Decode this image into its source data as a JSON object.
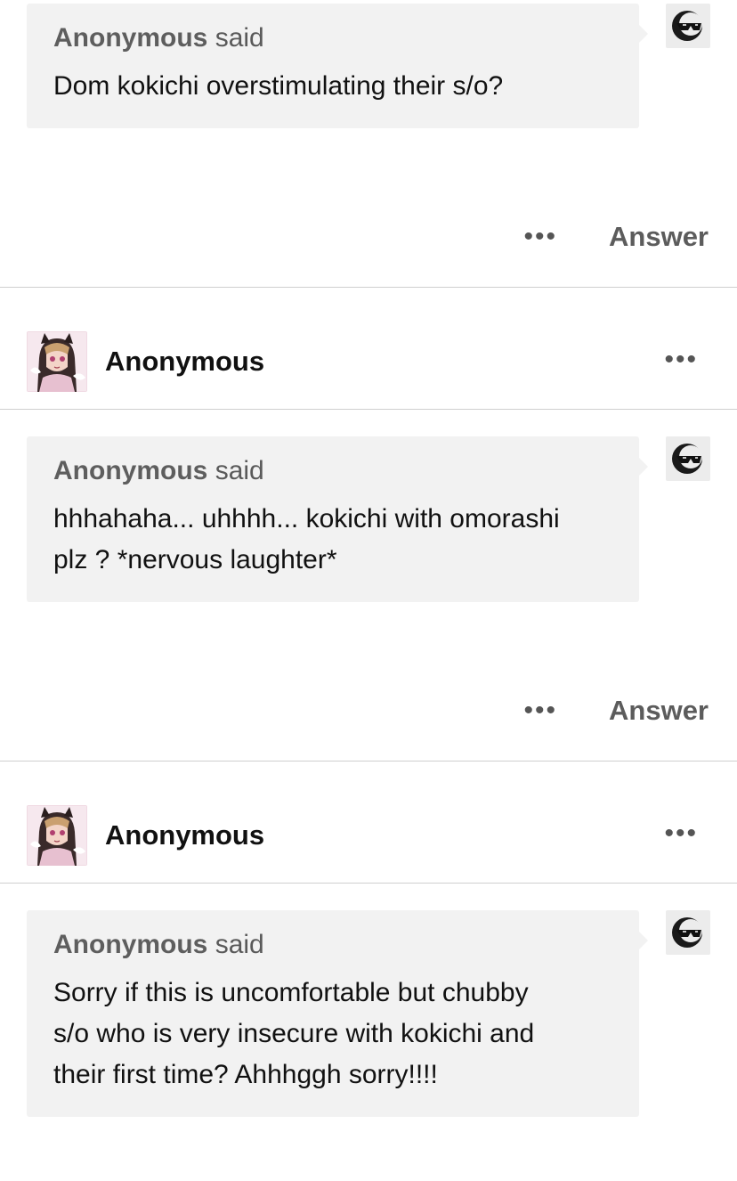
{
  "posts": [
    {
      "asker": "Anonymous",
      "said": "said",
      "question": "Dom kokichi overstimulating their s/o?",
      "more_label": "•••",
      "answer_label": "Answer"
    },
    {
      "username": "Anonymous",
      "header_more": "•••",
      "asker": "Anonymous",
      "said": "said",
      "question_lines": [
        "hhhahaha... uhhhh... kokichi with omorashi",
        "plz ? *nervous laughter*"
      ],
      "more_label": "•••",
      "answer_label": "Answer"
    },
    {
      "username": "Anonymous",
      "header_more": "•••",
      "asker": "Anonymous",
      "said": "said",
      "question_lines": [
        "Sorry if this is uncomfortable but chubby",
        "s/o who is very insecure with kokichi and",
        "their first time? Ahhhggh sorry!!!!"
      ]
    }
  ],
  "icons": {
    "anon_avatar": "sunglasses-icon",
    "user_avatar": "anime-avatar",
    "more": "more-dots-icon"
  },
  "colors": {
    "bubble": "#f2f2f2",
    "divider": "#cfcfcf",
    "muted_text": "#5a5a5a"
  }
}
